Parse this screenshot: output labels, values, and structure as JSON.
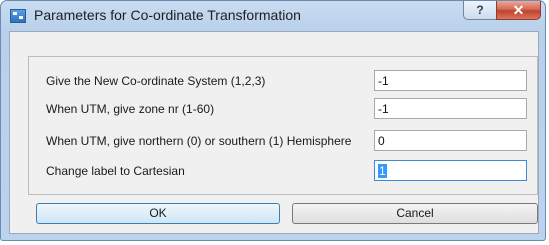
{
  "window": {
    "title": "Parameters for Co-ordinate Transformation",
    "help_glyph": "?",
    "close_glyph": "✕"
  },
  "fields": [
    {
      "label": "Give the New Co-ordinate System (1,2,3)",
      "value": "-1"
    },
    {
      "label": "When UTM, give zone nr (1-60)",
      "value": "-1"
    },
    {
      "label": "When UTM, give northern (0) or southern (1) Hemisphere",
      "value": "0"
    },
    {
      "label": "Change label to Cartesian",
      "value": "1"
    }
  ],
  "buttons": {
    "ok": "OK",
    "cancel": "Cancel"
  }
}
